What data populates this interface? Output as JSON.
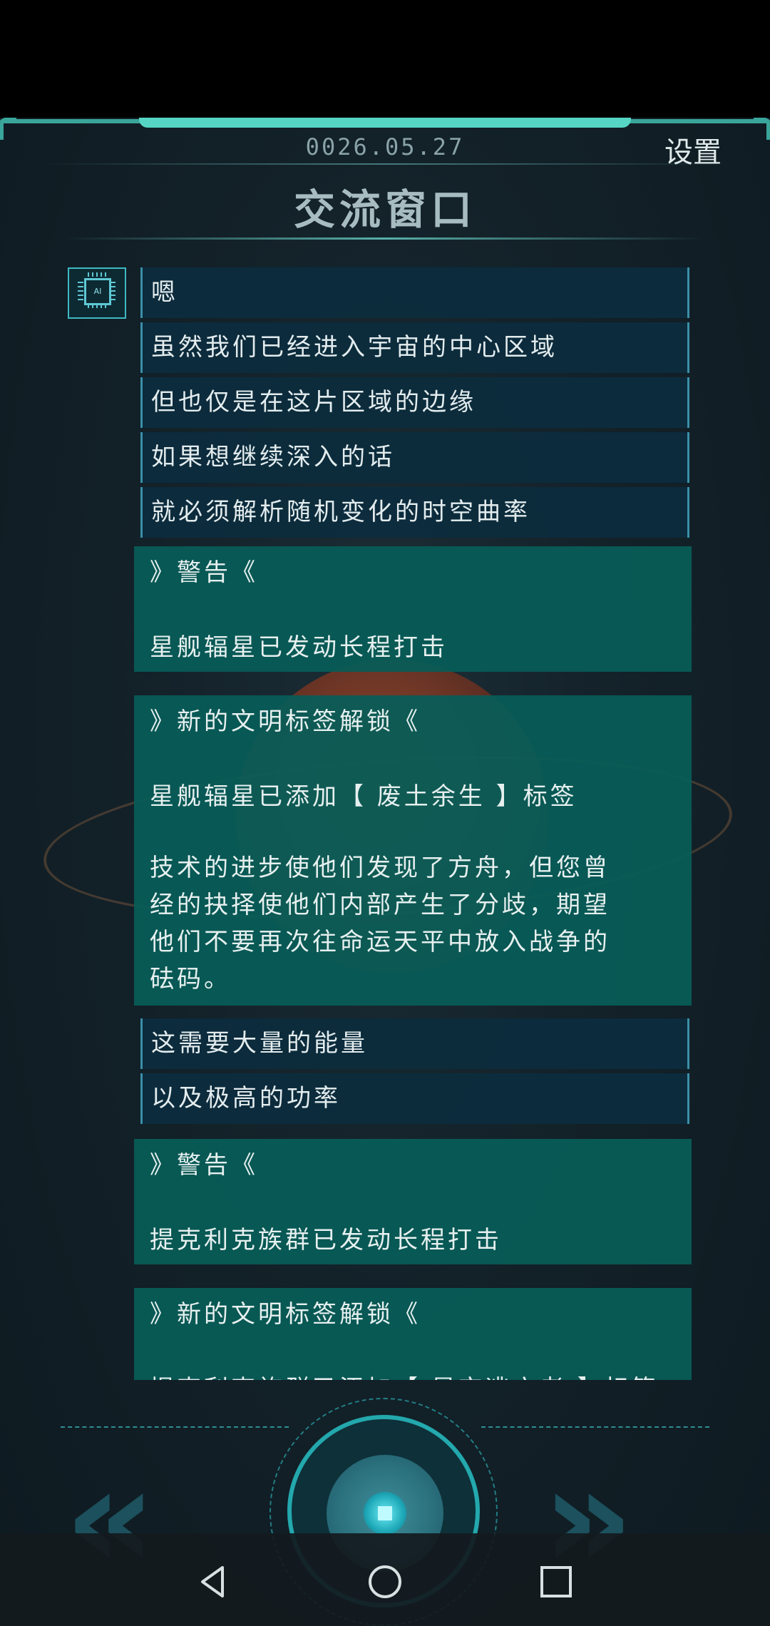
{
  "header": {
    "date": "0026.05.27",
    "settings_label": "设置",
    "title": "交流窗口"
  },
  "ai_avatar": {
    "label": "AI"
  },
  "messages": [
    "嗯",
    "虽然我们已经进入宇宙的中心区域",
    "但也仅是在这片区域的边缘",
    "如果想继续深入的话",
    "就必须解析随机变化的时空曲率"
  ],
  "notices": [
    {
      "heading": "》警告《",
      "body": "星舰辐星已发动长程打击"
    },
    {
      "heading": "》新的文明标签解锁《",
      "body": "星舰辐星已添加【 废土余生 】标签",
      "lines": [
        "技术的进步使他们发现了方舟，但您曾",
        "经的抉择使他们内部产生了分歧，期望",
        "他们不要再次往命运天平中放入战争的",
        "砝码。"
      ]
    }
  ],
  "messages_2": [
    "这需要大量的能量",
    "以及极高的功率"
  ],
  "notices_2": [
    {
      "heading": "》警告《",
      "body": "提克利克族群已发动长程打击"
    },
    {
      "heading": "》新的文明标签解锁《",
      "body": "提克利克族群已添加【 星空逃亡者 】标签"
    }
  ],
  "controls": {
    "prev_icon": "double-chevron-left-icon",
    "next_icon": "double-chevron-right-icon",
    "center_icon": "stop-square-icon"
  },
  "navbar": [
    "back-icon",
    "home-icon",
    "recent-apps-icon"
  ]
}
